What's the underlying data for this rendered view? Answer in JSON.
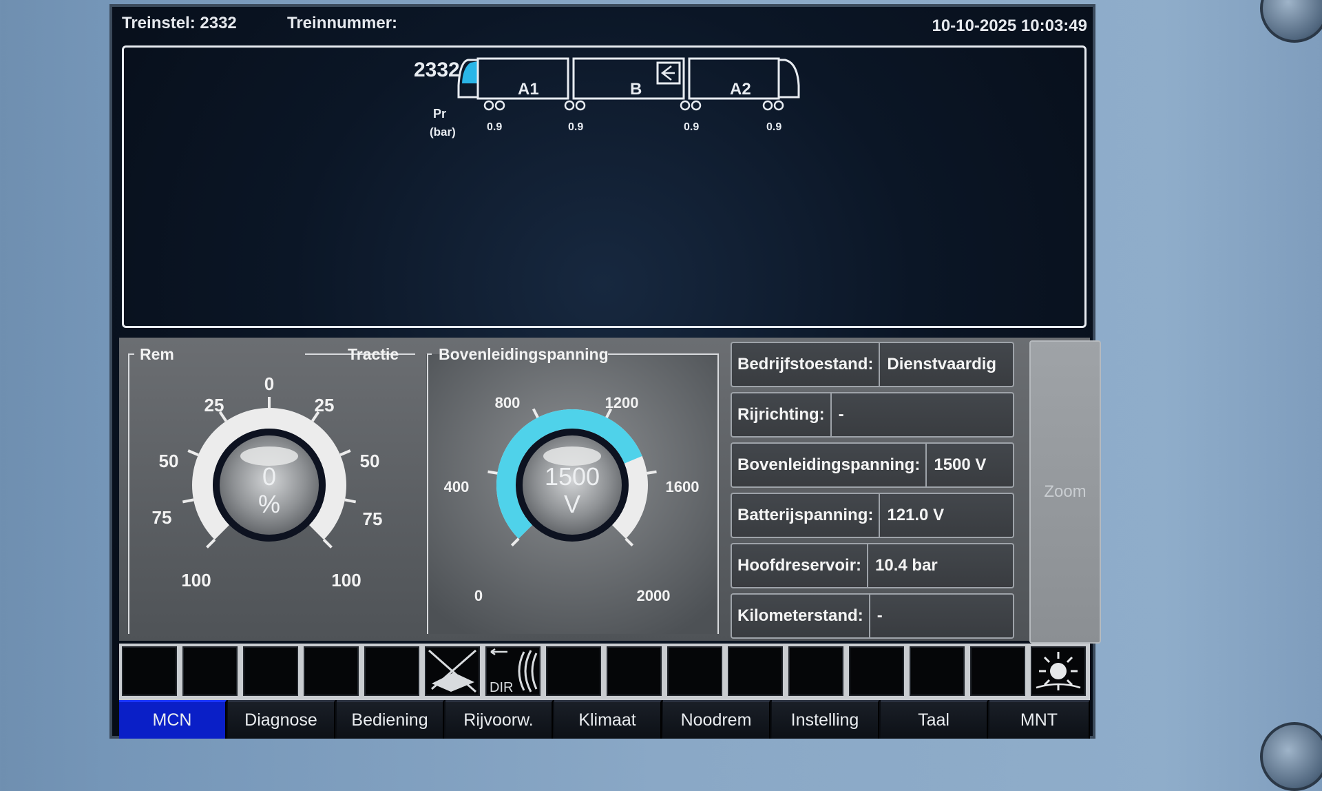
{
  "header": {
    "treinstel": "Treinstel: 2332",
    "treinnummer": "Treinnummer:",
    "datetime": "10-10-2025 10:03:49"
  },
  "train": {
    "number": "2332",
    "cars": [
      "A1",
      "B",
      "A2"
    ],
    "pressure_label_1": "Pr",
    "pressure_label_2": "(bar)",
    "pressures": [
      "0.9",
      "0.9",
      "0.9",
      "0.9"
    ]
  },
  "gauge_tractie": {
    "label_left": "Rem",
    "label_right": "Tractie",
    "ticks_top": "0",
    "ticks_left": [
      "25",
      "50",
      "75",
      "100"
    ],
    "ticks_right": [
      "25",
      "50",
      "75",
      "100"
    ],
    "value": "0",
    "unit": "%"
  },
  "gauge_voltage": {
    "label": "Bovenleidingspanning",
    "ticks": [
      "0",
      "400",
      "800",
      "1200",
      "1600",
      "2000"
    ],
    "value": "1500",
    "unit": "V",
    "fill_fraction": 0.75,
    "accent": "#4fd2ea"
  },
  "info": [
    {
      "key": "Bedrijfstoestand:",
      "value": "Dienstvaardig"
    },
    {
      "key": "Rijrichting:",
      "value": "-"
    },
    {
      "key": "Bovenleidingspanning:",
      "value": "1500 V"
    },
    {
      "key": "Batterijspanning:",
      "value": "121.0 V"
    },
    {
      "key": "Hoofdreservoir:",
      "value": "10.4 bar"
    },
    {
      "key": "Kilometerstand:",
      "value": "-"
    }
  ],
  "zoom_label": "Zoom",
  "dir_label": "DIR",
  "tabs": [
    "MCN",
    "Diagnose",
    "Bediening",
    "Rijvoorw.",
    "Klimaat",
    "Noodrem",
    "Instelling",
    "Taal",
    "MNT"
  ],
  "active_tab": "MCN"
}
